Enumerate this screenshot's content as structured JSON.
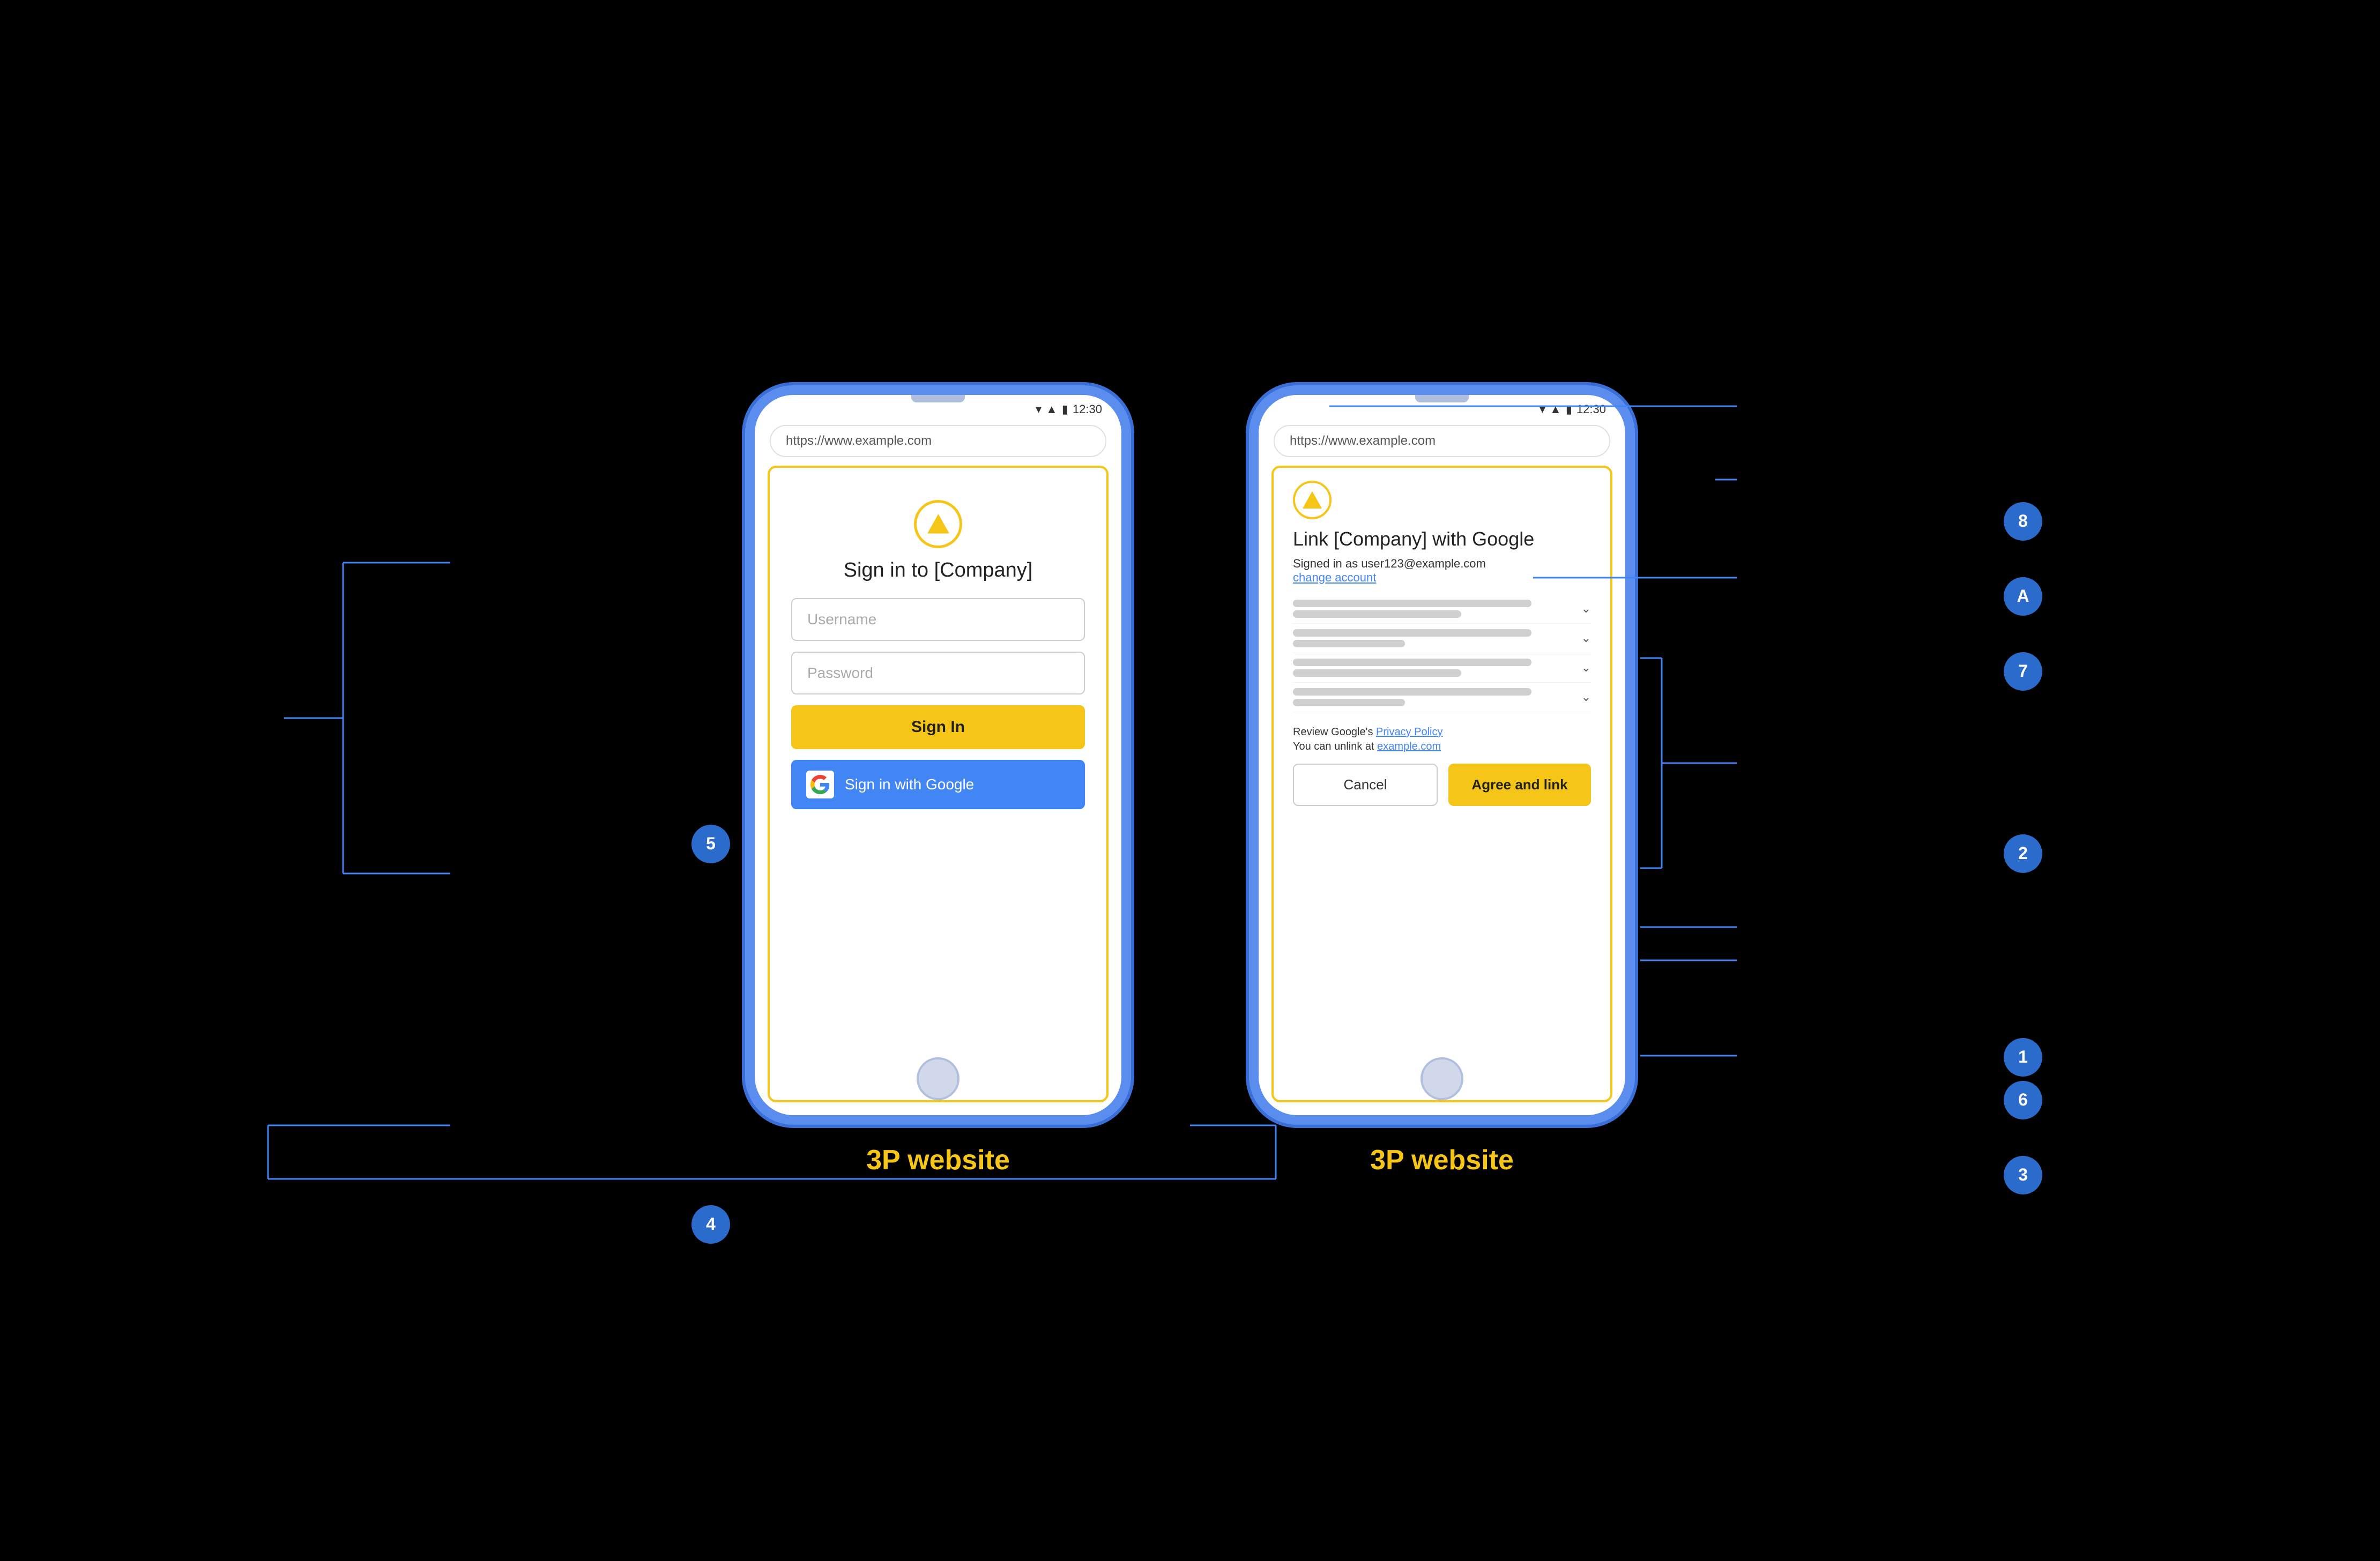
{
  "left_phone": {
    "url": "https://www.example.com",
    "status_time": "12:30",
    "logo_alt": "Company logo triangle",
    "title": "Sign in to [Company]",
    "username_placeholder": "Username",
    "password_placeholder": "Password",
    "sign_in_label": "Sign In",
    "google_btn_label": "Sign in with Google",
    "label": "3P website"
  },
  "right_phone": {
    "url": "https://www.example.com",
    "status_time": "12:30",
    "logo_alt": "Company logo triangle",
    "title": "Link [Company] with Google",
    "signed_in_text": "Signed in as user123@example.com",
    "change_account_label": "change account",
    "privacy_policy_text": "Review Google's ",
    "privacy_policy_link": "Privacy Policy",
    "unlink_text": "You can unlink at ",
    "unlink_link": "example.com",
    "cancel_label": "Cancel",
    "agree_label": "Agree and link",
    "label": "3P website"
  },
  "annotations": {
    "num1": "1",
    "num2": "2",
    "num3": "3",
    "num4": "4",
    "num5": "5",
    "num6": "6",
    "num7": "7",
    "num8": "8",
    "letterA": "A"
  }
}
